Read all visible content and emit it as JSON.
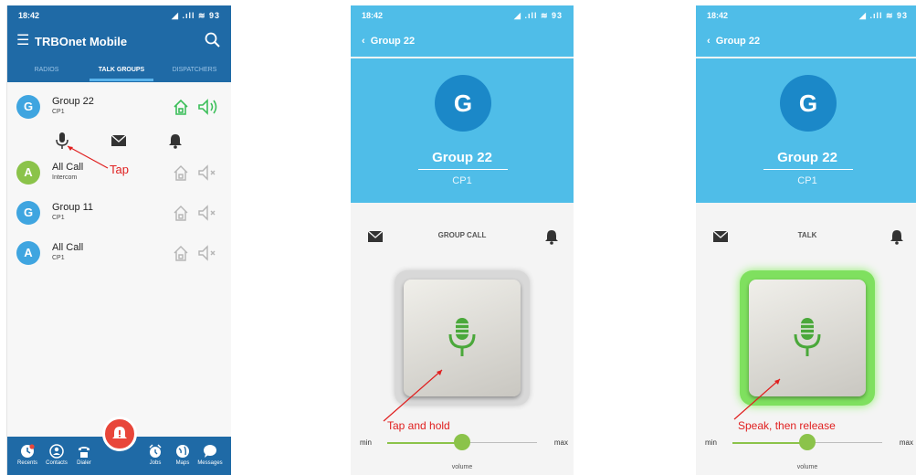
{
  "colors": {
    "primary": "#1f6aa6",
    "accent_light": "#4fbde8",
    "green": "#5bc236",
    "red": "#e02020",
    "sos": "#e8463a"
  },
  "phone1": {
    "status": {
      "time": "18:42",
      "icons": "◢ .ıll ≋ 93"
    },
    "app_title": "TRBOnet Mobile",
    "tabs": [
      {
        "label": "RADIOS",
        "active": false
      },
      {
        "label": "TALK GROUPS",
        "active": true
      },
      {
        "label": "DISPATCHERS",
        "active": false
      }
    ],
    "rows": [
      {
        "initial": "G",
        "name": "Group 22",
        "sub": "CP1",
        "active": true,
        "color": "#3fa5e0"
      },
      {
        "initial": "A",
        "name": "All Call",
        "sub": "Intercom",
        "active": false,
        "color": "#8bc34a"
      },
      {
        "initial": "G",
        "name": "Group 11",
        "sub": "CP1",
        "active": false,
        "color": "#3fa5e0"
      },
      {
        "initial": "A",
        "name": "All Call",
        "sub": "CP1",
        "active": false,
        "color": "#3fa5e0"
      }
    ],
    "annotation": "Tap",
    "nav": [
      "Recents",
      "Contacts",
      "Dialer",
      "Jobs",
      "Maps",
      "Messages"
    ]
  },
  "phone2": {
    "status": {
      "time": "18:42",
      "icons": "◢ .ıll ≋ 93"
    },
    "back_title": "Group 22",
    "initial": "G",
    "name": "Group 22",
    "sub": "CP1",
    "mode": "GROUP CALL",
    "hint": "Tap and hold",
    "vol_min": "min",
    "vol_max": "max",
    "vol_label": "volume",
    "volume_level": 0.5
  },
  "phone3": {
    "status": {
      "time": "18:42",
      "icons": "◢ .ıll ≋ 93"
    },
    "back_title": "Group 22",
    "initial": "G",
    "name": "Group 22",
    "sub": "CP1",
    "mode": "TALK",
    "hint": "Speak, then release",
    "vol_min": "min",
    "vol_max": "max",
    "vol_label": "volume",
    "volume_level": 0.5
  }
}
